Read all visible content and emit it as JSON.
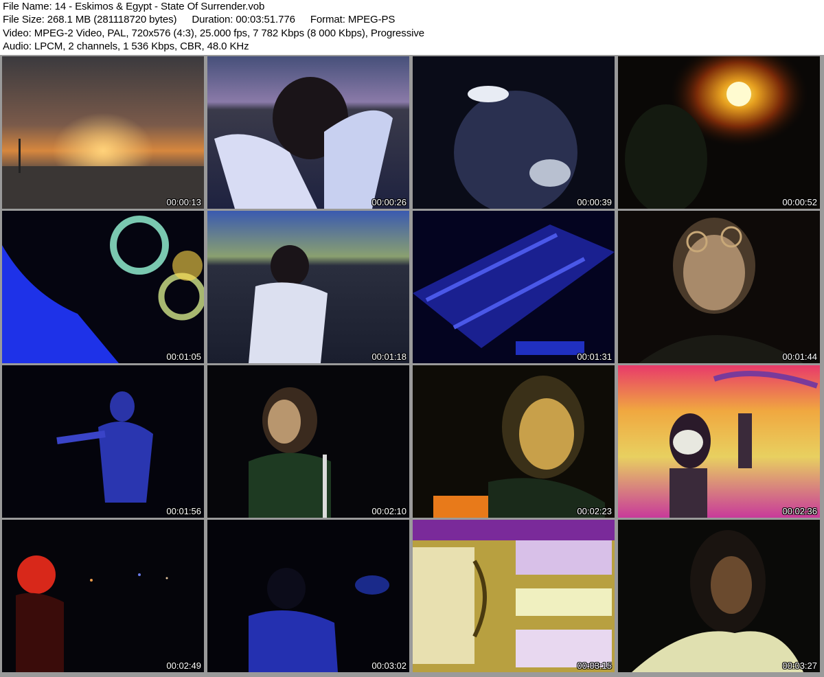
{
  "header": {
    "file_name": "File Name: 14 - Eskimos & Egypt - State Of Surrender.vob",
    "file_size": "File Size: 268.1 MB (281118720 bytes)",
    "duration": "Duration: 00:03:51.776",
    "format": "Format: MPEG-PS",
    "video": "Video: MPEG-2 Video, PAL, 720x576 (4:3), 25.000 fps, 7 782 Kbps (8 000 Kbps), Progressive",
    "audio": "Audio: LPCM, 2 channels, 1 536 Kbps, CBR, 48.0 KHz"
  },
  "thumbnails": [
    {
      "time": "00:00:13"
    },
    {
      "time": "00:00:26"
    },
    {
      "time": "00:00:39"
    },
    {
      "time": "00:00:52"
    },
    {
      "time": "00:01:05"
    },
    {
      "time": "00:01:18"
    },
    {
      "time": "00:01:31"
    },
    {
      "time": "00:01:44"
    },
    {
      "time": "00:01:56"
    },
    {
      "time": "00:02:10"
    },
    {
      "time": "00:02:23"
    },
    {
      "time": "00:02:36"
    },
    {
      "time": "00:02:49"
    },
    {
      "time": "00:03:02"
    },
    {
      "time": "00:03:15"
    },
    {
      "time": "00:03:27"
    }
  ]
}
